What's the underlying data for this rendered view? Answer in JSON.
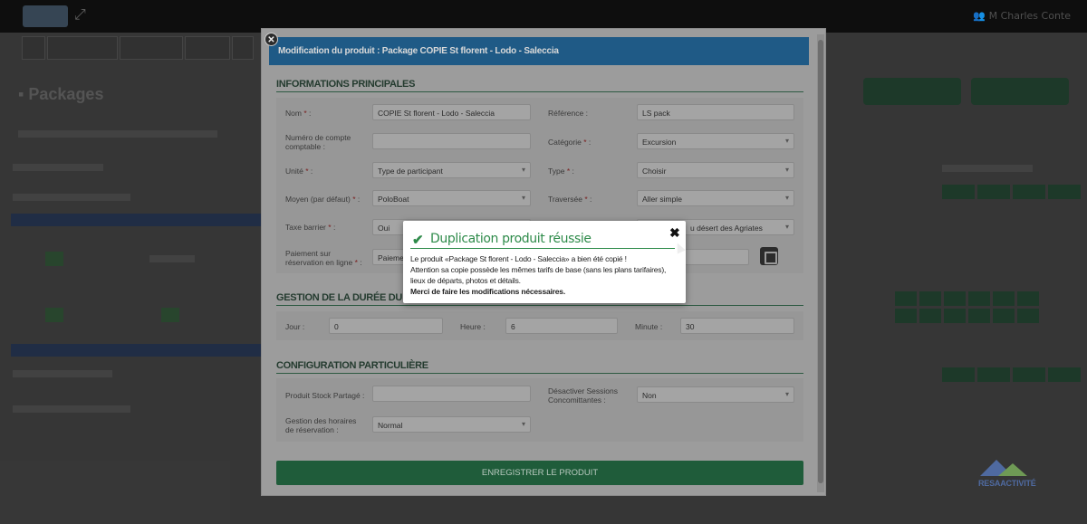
{
  "header": {
    "user_name": "M Charles Conte"
  },
  "page": {
    "title": "Packages"
  },
  "modal": {
    "title": "Modification du produit : Package COPIE St florent - Lodo - Saleccia",
    "save_button": "ENREGISTRER LE PRODUIT",
    "sections": {
      "main": "INFORMATIONS PRINCIPALES",
      "duration": "GESTION DE LA DURÉE DU PRODUIT",
      "config": "CONFIGURATION PARTICULIÈRE"
    },
    "fields": {
      "nom": {
        "label": "Nom",
        "value": "COPIE St florent - Lodo - Saleccia"
      },
      "reference": {
        "label": "Référence :",
        "value": "LS pack"
      },
      "numero_compte": {
        "label": "Numéro de compte comptable :",
        "value": ""
      },
      "categorie": {
        "label": "Catégorie",
        "value": "Excursion"
      },
      "unite": {
        "label": "Unité",
        "value": "Type de participant"
      },
      "type": {
        "label": "Type",
        "value": "Choisir"
      },
      "moyen": {
        "label": "Moyen (par défaut)",
        "value": "PoloBoat"
      },
      "traversee": {
        "label": "Traversée",
        "value": "Aller simple"
      },
      "taxe": {
        "label": "Taxe barrier",
        "value": "Oui"
      },
      "lieu_value": "u désert des Agriates",
      "paiement": {
        "label": "Paiement sur réservation en ligne",
        "value": "Paiemen"
      },
      "jour": {
        "label": "Jour :",
        "value": "0"
      },
      "heure": {
        "label": "Heure :",
        "value": "6"
      },
      "minute": {
        "label": "Minute :",
        "value": "30"
      },
      "stock": {
        "label": "Produit Stock Partagé :",
        "value": ""
      },
      "desactiver": {
        "label": "Désactiver Sessions Concomittantes :",
        "value": "Non"
      },
      "horaires": {
        "label": "Gestion des horaires de réservation :",
        "value": "Normal"
      }
    },
    "required_mark": "*"
  },
  "toast": {
    "title": "Duplication produit réussie",
    "line1": "Le produit «Package St florent - Lodo - Saleccia» a bien été copié !",
    "line2": "Attention sa copie possède les mêmes tarifs de base (sans les plans tarifaires), lieux de départs, photos et détails.",
    "line3": "Merci de faire les modifications nécessaires.",
    "accent_color": "#2e8b4a"
  },
  "brand": {
    "name": "RESAACTIVITÉ"
  }
}
